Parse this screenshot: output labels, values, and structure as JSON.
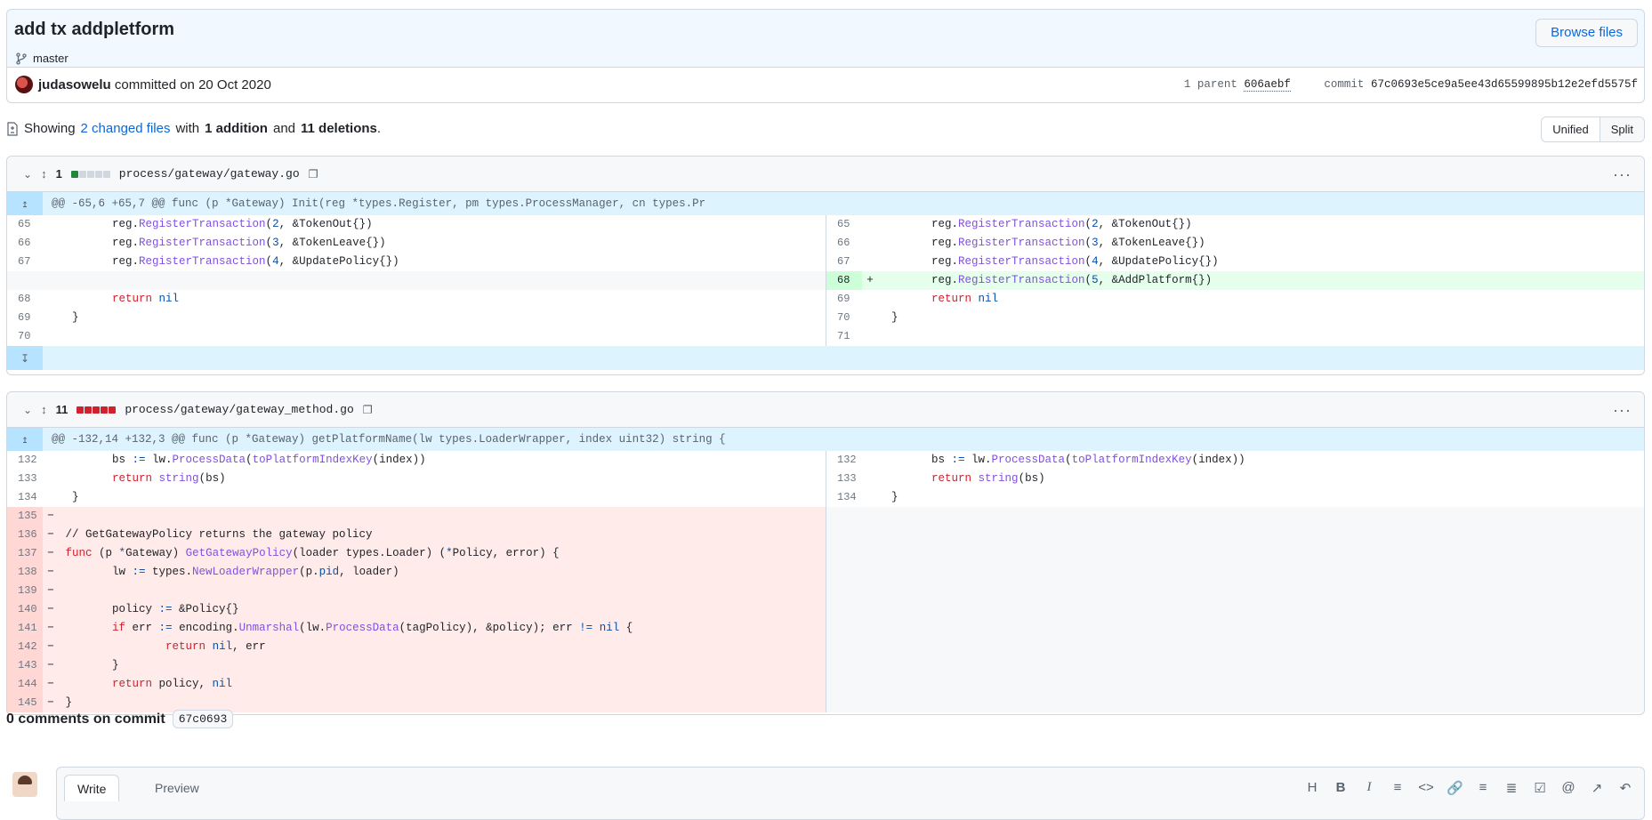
{
  "commit": {
    "title": "add tx addpletform",
    "branch": "master",
    "browse_label": "Browse files",
    "author": "judasowelu",
    "committed_text": "committed on 20 Oct 2020",
    "parent_label": "1 parent",
    "parent_sha": "606aebf",
    "commit_label": "commit",
    "commit_sha": "67c0693e5ce9a5ee43d65599895b12e2efd5575f"
  },
  "summary": {
    "showing": "Showing",
    "changed_files": "2 changed files",
    "with": "with",
    "additions": "1 addition",
    "and": "and",
    "deletions": "11 deletions",
    "end": "."
  },
  "view_toggle": {
    "unified": "Unified",
    "split": "Split"
  },
  "files": [
    {
      "count": "1",
      "path": "process/gateway/gateway.go",
      "hunk": "@@ -65,6 +65,7 @@ func (p *Gateway) Init(reg *types.Register, pm types.ProcessManager, cn types.Pr"
    },
    {
      "count": "11",
      "path": "process/gateway/gateway_method.go",
      "hunk": "@@ -132,14 +132,3 @@ func (p *Gateway) getPlatformName(lw types.LoaderWrapper, index uint32) string {"
    }
  ],
  "comments": {
    "title": "0 comments on commit",
    "sha": "67c0693"
  },
  "editor": {
    "write": "Write",
    "preview": "Preview"
  }
}
